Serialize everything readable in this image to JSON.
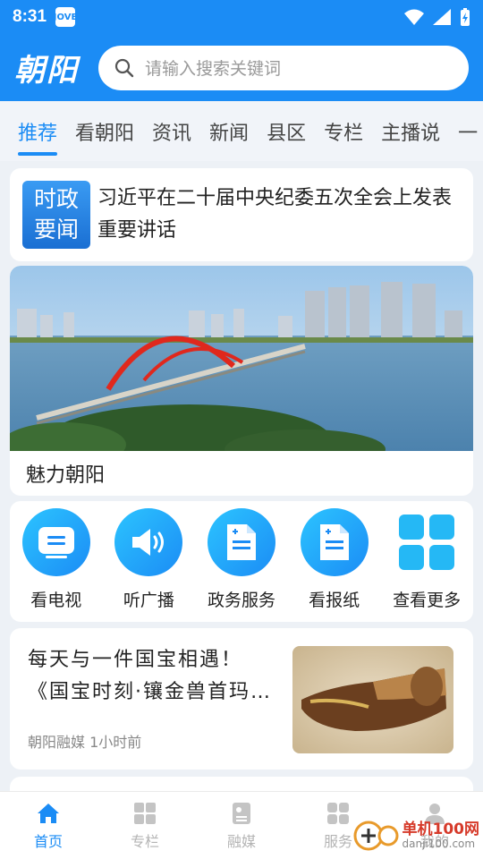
{
  "status": {
    "time": "8:31",
    "app_badge": "JOVE"
  },
  "header": {
    "logo": "朝阳",
    "search_placeholder": "请输入搜索关键词"
  },
  "tabs": [
    "推荐",
    "看朝阳",
    "资讯",
    "新闻",
    "县区",
    "专栏",
    "主播说",
    "一"
  ],
  "headline": {
    "badge_line1": "时政",
    "badge_line2": "要闻",
    "text": "习近平在二十届中央纪委五次全会上发表重要讲话"
  },
  "banner": {
    "caption": "魅力朝阳"
  },
  "services": [
    {
      "label": "看电视",
      "icon": "tv-icon"
    },
    {
      "label": "听广播",
      "icon": "speaker-icon"
    },
    {
      "label": "政务服务",
      "icon": "document-icon"
    },
    {
      "label": "看报纸",
      "icon": "newspaper-icon"
    },
    {
      "label": "查看更多",
      "icon": "grid-icon"
    }
  ],
  "article": {
    "title": "每天与一件国宝相遇！《国宝时刻·镶金兽首玛…",
    "source": "朝阳融媒",
    "time": "1小时前"
  },
  "bottom_nav": [
    {
      "label": "首页",
      "icon": "home-icon",
      "active": true
    },
    {
      "label": "专栏",
      "icon": "columns-icon",
      "active": false
    },
    {
      "label": "融媒",
      "icon": "media-icon",
      "active": false
    },
    {
      "label": "服务",
      "icon": "services-icon",
      "active": false
    },
    {
      "label": "我的",
      "icon": "profile-icon",
      "active": false
    }
  ],
  "watermark": {
    "text": "单机100网",
    "sub": "danji100.com"
  },
  "colors": {
    "accent": "#1b8cf5",
    "background": "#edf1f6"
  }
}
